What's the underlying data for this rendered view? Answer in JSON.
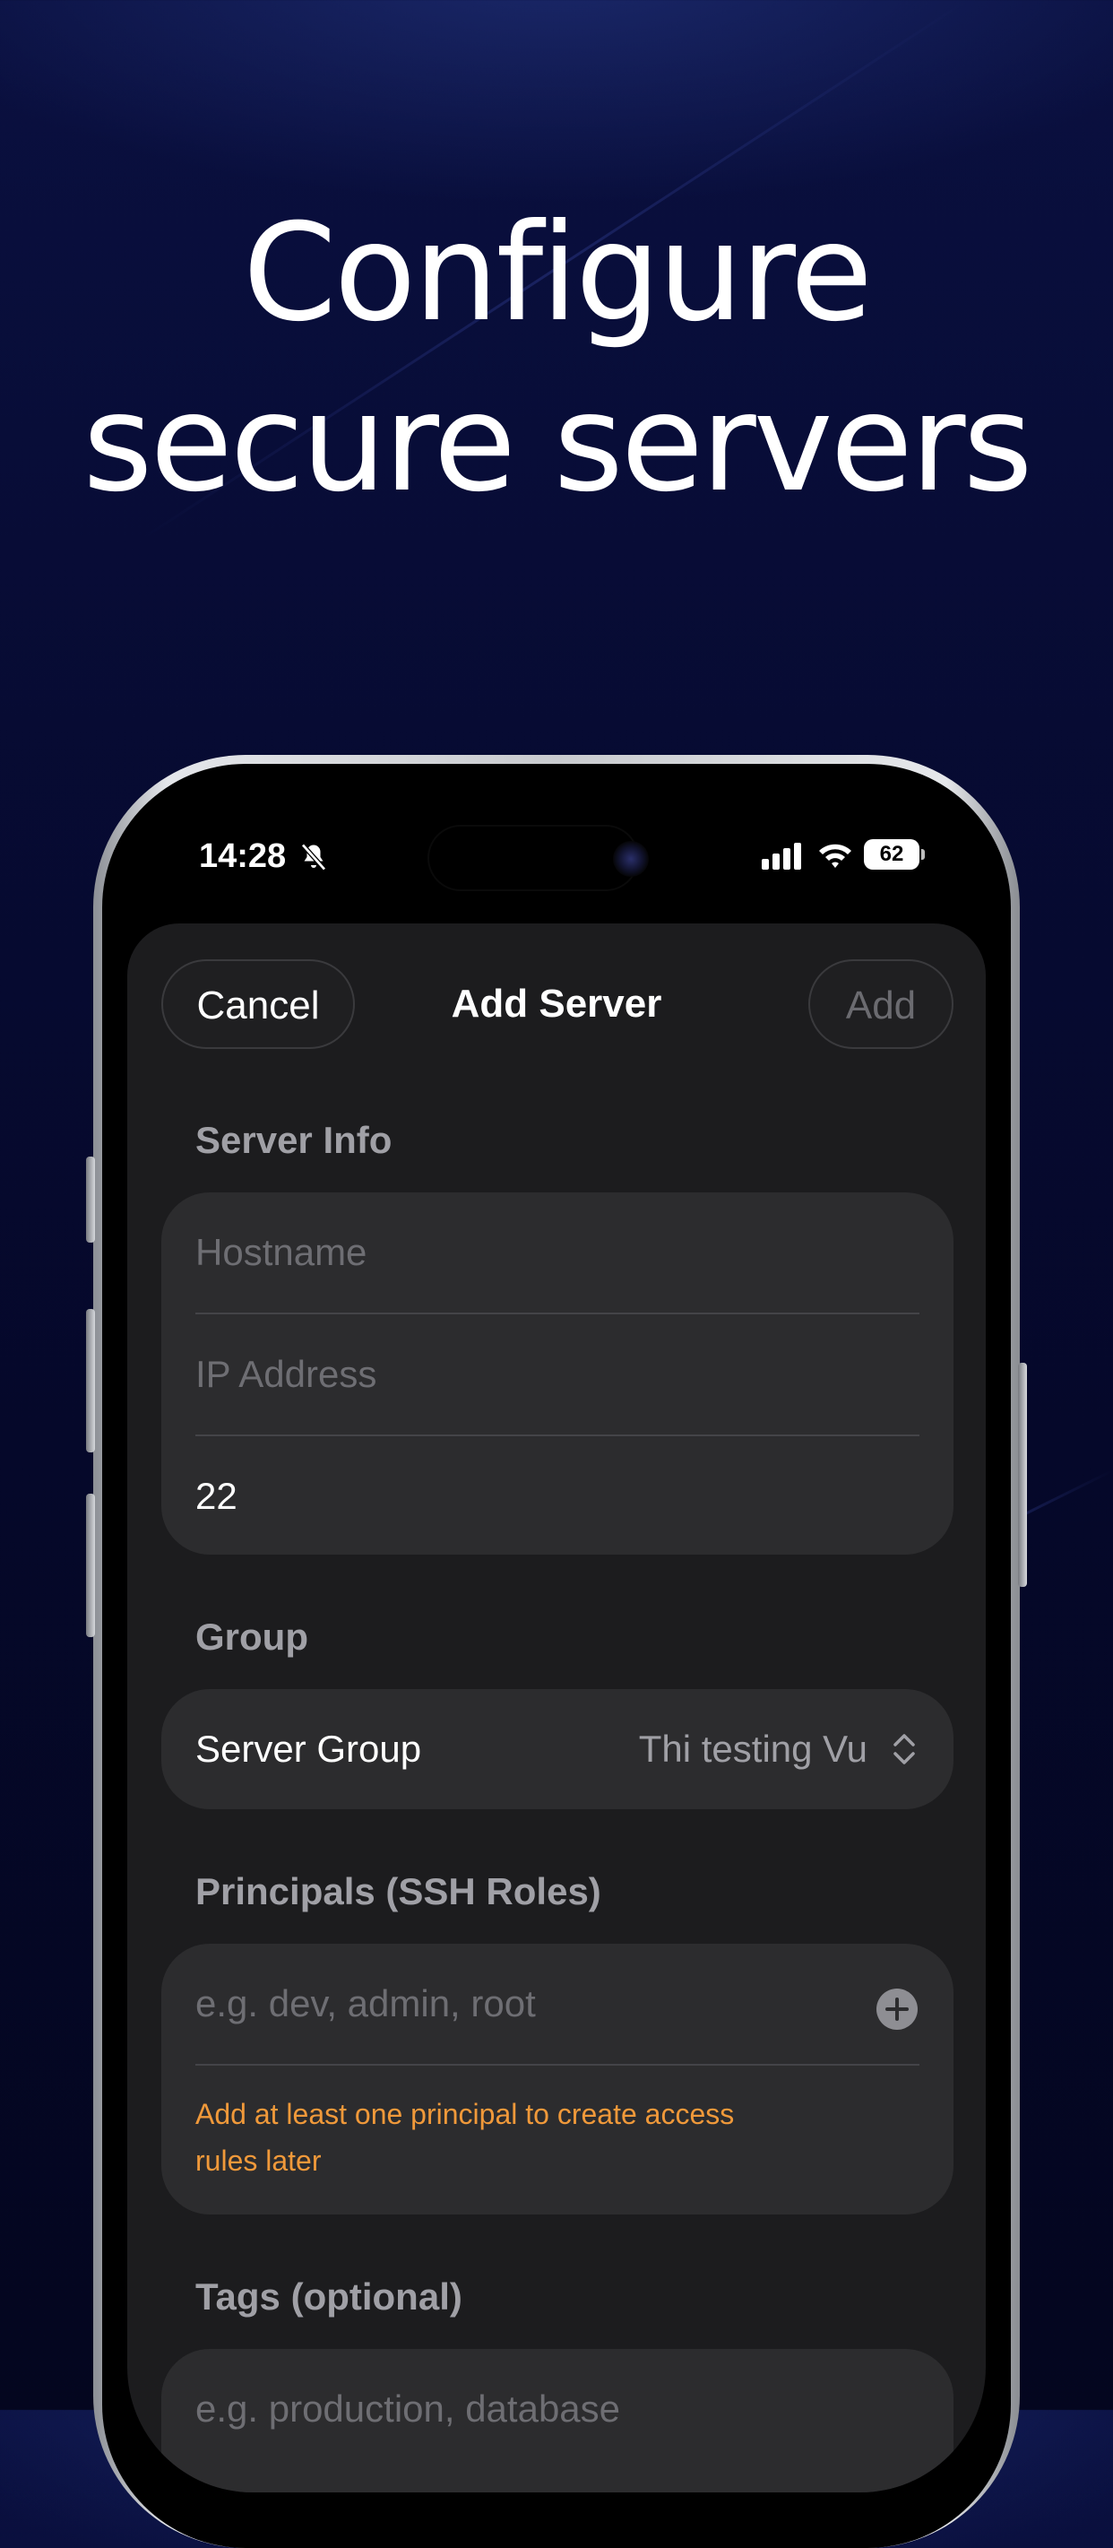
{
  "headline": {
    "line1": "Configure",
    "line2": "secure servers"
  },
  "status_bar": {
    "time": "14:28",
    "battery": "62",
    "icons": [
      "bell-slash-icon",
      "signal-icon",
      "wifi-icon",
      "battery-icon"
    ]
  },
  "nav": {
    "cancel_label": "Cancel",
    "title": "Add Server",
    "add_label": "Add"
  },
  "server_info": {
    "label": "Server Info",
    "hostname_placeholder": "Hostname",
    "ip_placeholder": "IP Address",
    "port_value": "22"
  },
  "group": {
    "label": "Group",
    "field_label": "Server Group",
    "selected_value": "Thi testing Vu"
  },
  "principals": {
    "label": "Principals (SSH Roles)",
    "placeholder": "e.g. dev, admin, root",
    "hint_line1": "Add at least one principal to create access",
    "hint_line2": "rules later"
  },
  "tags": {
    "label": "Tags (optional)",
    "placeholder": "e.g. production, database"
  },
  "colors": {
    "background": "#05082a",
    "sheet": "#1c1c1e",
    "card": "#2c2c2e",
    "warning": "#f0993a"
  }
}
